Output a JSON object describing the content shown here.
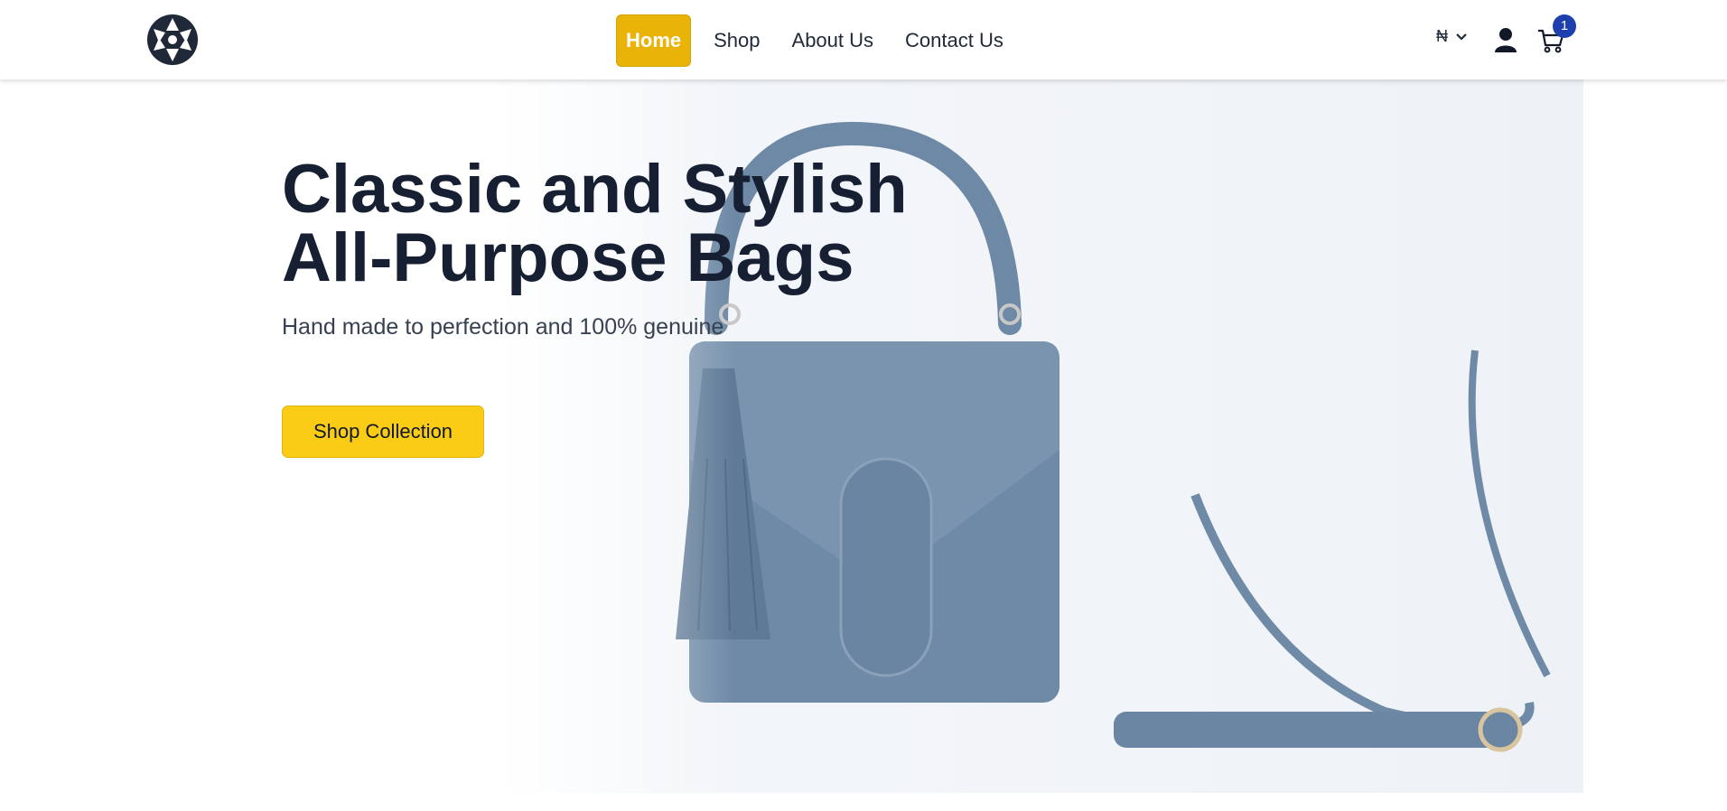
{
  "nav": {
    "logo_icon": "geometric-pinwheel-logo",
    "links": [
      {
        "label": "Home",
        "active": true
      },
      {
        "label": "Shop",
        "active": false
      },
      {
        "label": "About Us",
        "active": false
      },
      {
        "label": "Contact Us",
        "active": false
      }
    ],
    "currency": "₦",
    "currency_dropdown_icon": "chevron-down-icon",
    "user_icon": "user-icon",
    "cart_icon": "cart-icon",
    "cart_count": "1"
  },
  "hero": {
    "title_line1": "Classic and Stylish",
    "title_line2": "All-Purpose Bags",
    "subtitle": "Hand made to perfection and 100% genuine",
    "cta_label": "Shop Collection",
    "image": "blue-croc-leather-handbag"
  },
  "colors": {
    "accent": "#facc15",
    "nav_active": "#eab308",
    "badge": "#1e40af",
    "text_dark": "#172033",
    "bag_blue": "#6f8aa6"
  }
}
